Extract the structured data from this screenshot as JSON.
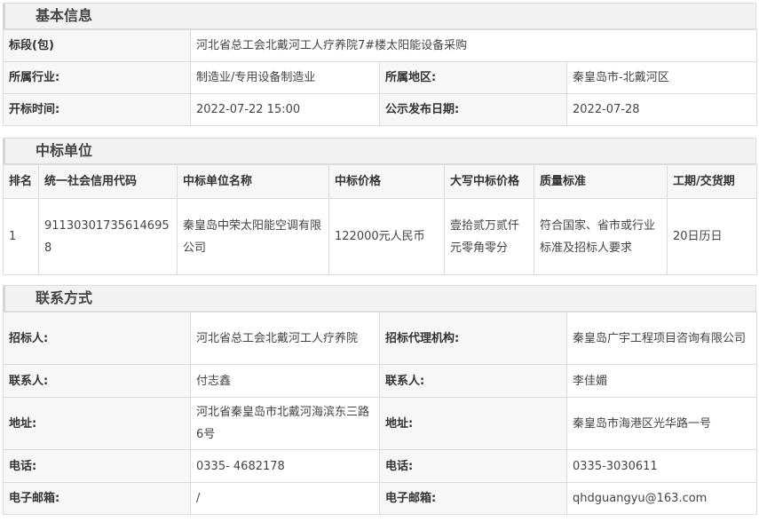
{
  "basic": {
    "title": "基本信息",
    "rows": [
      {
        "label": "标段(包)",
        "value": "河北省总工会北戴河工人疗养院7#楼太阳能设备采购"
      },
      {
        "label": "所属行业:",
        "value": "制造业/专用设备制造业",
        "label2": "所属地区:",
        "value2": "秦皇岛市-北戴河区"
      },
      {
        "label": "开标时间:",
        "value": "2022-07-22 15:00",
        "label2": "公示发布日期:",
        "value2": "2022-07-28"
      }
    ]
  },
  "winner": {
    "title": "中标单位",
    "headers": [
      "排名",
      "统一社会信用代码",
      "中标单位名称",
      "中标价格",
      "大写中标价格",
      "质量标准",
      "工期/交货期"
    ],
    "rows": [
      [
        "1",
        "911303017356146958",
        "秦皇岛中荣太阳能空调有限公司",
        "122000元人民币",
        "壹拾贰万贰仟元零角零分",
        "符合国家、省市或行业标准及招标人要求",
        "20日历日"
      ]
    ]
  },
  "contact": {
    "title": "联系方式",
    "rows": [
      {
        "label": "招标人:",
        "value": "河北省总工会北戴河工人疗养院",
        "label2": "招标代理机构:",
        "value2": "秦皇岛广宇工程项目咨询有限公司"
      },
      {
        "label": "联系人:",
        "value": "付志鑫",
        "label2": "联系人:",
        "value2": "李佳媚"
      },
      {
        "label": "地址:",
        "value": "河北省秦皇岛市北戴河海滨东三路6号",
        "label2": "地址:",
        "value2": "秦皇岛市海港区光华路一号"
      },
      {
        "label": "电话:",
        "value": "0335- 4682178",
        "label2": "电话:",
        "value2": "0335-3030611"
      },
      {
        "label": "电子邮箱:",
        "value": "/",
        "label2": "电子邮箱:",
        "value2": "qhdguangyu@163.com"
      }
    ]
  }
}
